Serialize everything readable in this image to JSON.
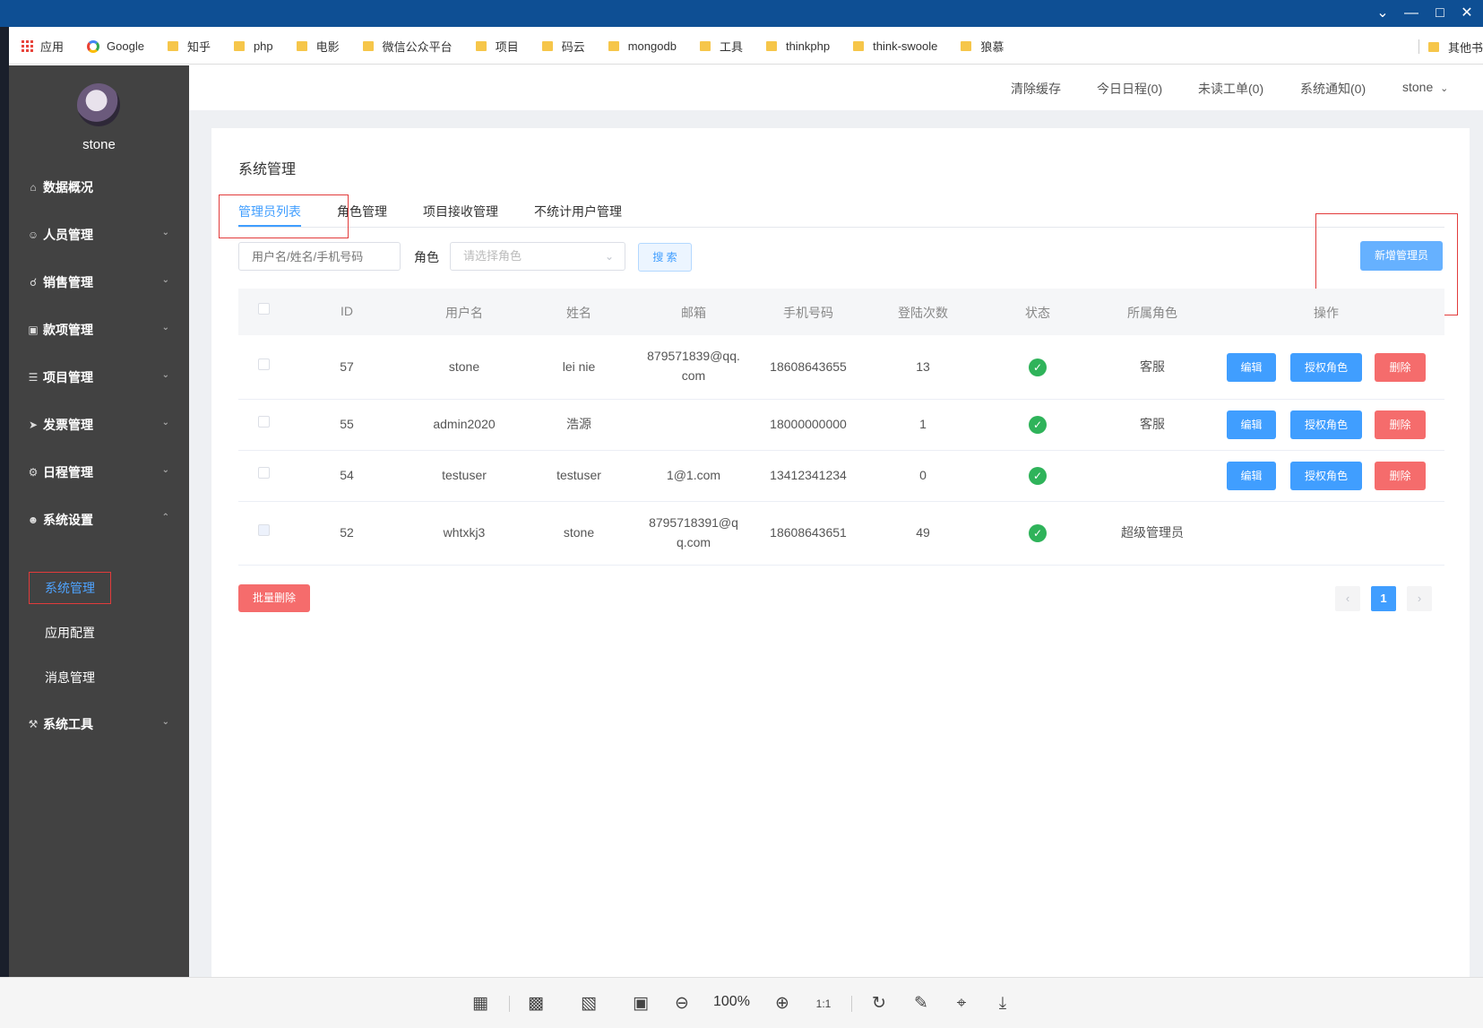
{
  "bookmarks": {
    "apps": "应用",
    "google": "Google",
    "folders": [
      "知乎",
      "php",
      "电影",
      "微信公众平台",
      "项目",
      "码云",
      "mongodb",
      "工具",
      "thinkphp",
      "think-swoole",
      "狼慕"
    ],
    "other": "其他书"
  },
  "sidebar": {
    "username": "stone",
    "items": [
      {
        "label": "数据概况",
        "icon": "home-icon"
      },
      {
        "label": "人员管理",
        "icon": "user-icon"
      },
      {
        "label": "销售管理",
        "icon": "cart-icon"
      },
      {
        "label": "款项管理",
        "icon": "money-icon"
      },
      {
        "label": "项目管理",
        "icon": "database-icon"
      },
      {
        "label": "发票管理",
        "icon": "send-icon"
      },
      {
        "label": "日程管理",
        "icon": "gear-icon"
      },
      {
        "label": "系统设置",
        "icon": "users-icon"
      },
      {
        "label": "系统工具",
        "icon": "wrench-icon"
      }
    ],
    "sub_items": [
      "系统管理",
      "应用配置",
      "消息管理"
    ]
  },
  "topnav": {
    "clear_cache": "清除缓存",
    "today_schedule": "今日日程(0)",
    "unread_tickets": "未读工单(0)",
    "notifications": "系统通知(0)",
    "user": "stone"
  },
  "page": {
    "title": "系统管理",
    "tabs": [
      "管理员列表",
      "角色管理",
      "项目接收管理",
      "不统计用户管理"
    ],
    "search_placeholder": "用户名/姓名/手机号码",
    "role_label": "角色",
    "role_placeholder": "请选择角色",
    "search_button": "搜 索",
    "add_button": "新增管理员",
    "batch_delete": "批量删除",
    "current_page": "1"
  },
  "table": {
    "headers": [
      "ID",
      "用户名",
      "姓名",
      "邮箱",
      "手机号码",
      "登陆次数",
      "状态",
      "所属角色",
      "操作"
    ],
    "rows": [
      {
        "id": "57",
        "username": "stone",
        "name": "lei nie",
        "email": "879571839@qq.com",
        "email_l1": "879571839@qq.",
        "email_l2": "com",
        "phone": "18608643655",
        "logins": "13",
        "role": "客服"
      },
      {
        "id": "55",
        "username": "admin2020",
        "name": "浩源",
        "email": "",
        "phone": "18000000000",
        "logins": "1",
        "role": "客服"
      },
      {
        "id": "54",
        "username": "testuser",
        "name": "testuser",
        "email": "1@1.com",
        "phone": "13412341234",
        "logins": "0",
        "role": ""
      },
      {
        "id": "52",
        "username": "whtxkj3",
        "name": "stone",
        "email": "8795718391@qq.com",
        "email_l1": "8795718391@q",
        "email_l2": "q.com",
        "phone": "18608643651",
        "logins": "49",
        "role": "超级管理员"
      }
    ],
    "actions": {
      "edit": "编辑",
      "grant": "授权角色",
      "delete": "删除"
    }
  },
  "viewer": {
    "zoom": "100%"
  }
}
